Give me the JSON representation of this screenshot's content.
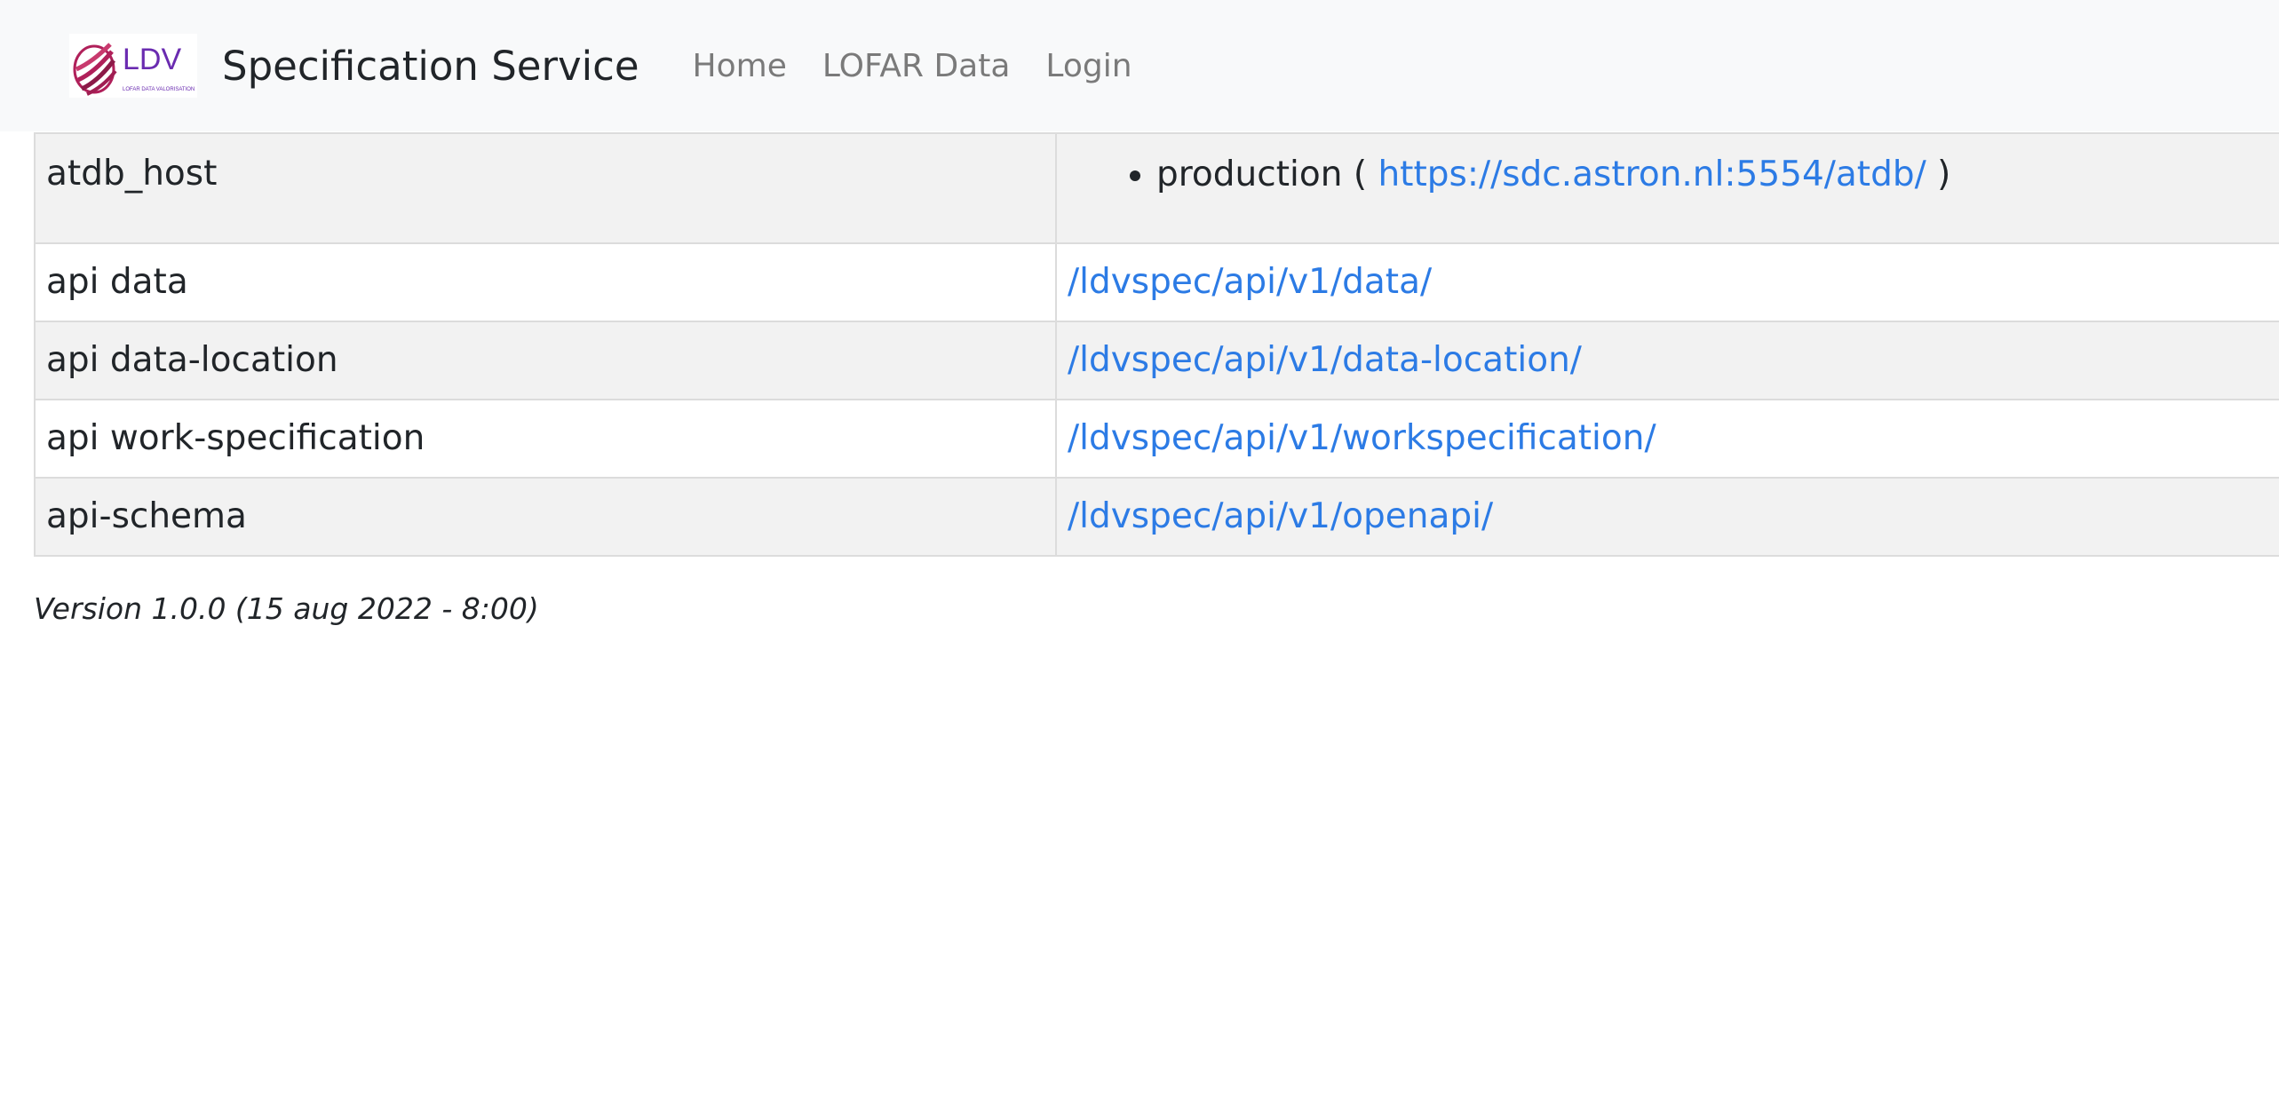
{
  "navbar": {
    "logo_text": "LDV",
    "logo_subtext": "LOFAR DATA VALORISATION",
    "title": "Specification Service",
    "links": [
      {
        "label": "Home"
      },
      {
        "label": "LOFAR Data"
      },
      {
        "label": "Login"
      }
    ]
  },
  "table": {
    "atdb_host": {
      "key": "atdb_host",
      "item_prefix": "production (",
      "item_link": "https://sdc.astron.nl:5554/atdb/",
      "item_suffix": ")"
    },
    "rows": [
      {
        "key": "api data",
        "value": "/ldvspec/api/v1/data/"
      },
      {
        "key": "api data-location",
        "value": "/ldvspec/api/v1/data-location/"
      },
      {
        "key": "api work-specification",
        "value": "/ldvspec/api/v1/workspecification/"
      },
      {
        "key": "api-schema",
        "value": "/ldvspec/api/v1/openapi/"
      }
    ]
  },
  "footer": {
    "version": "Version 1.0.0 (15 aug 2022 - 8:00)"
  },
  "colors": {
    "navbar_bg": "#f8f9fa",
    "link": "#2c7be5",
    "row_alt": "#f2f2f2",
    "logo_purple": "#6a2bb0",
    "logo_magenta": "#b0205a"
  }
}
